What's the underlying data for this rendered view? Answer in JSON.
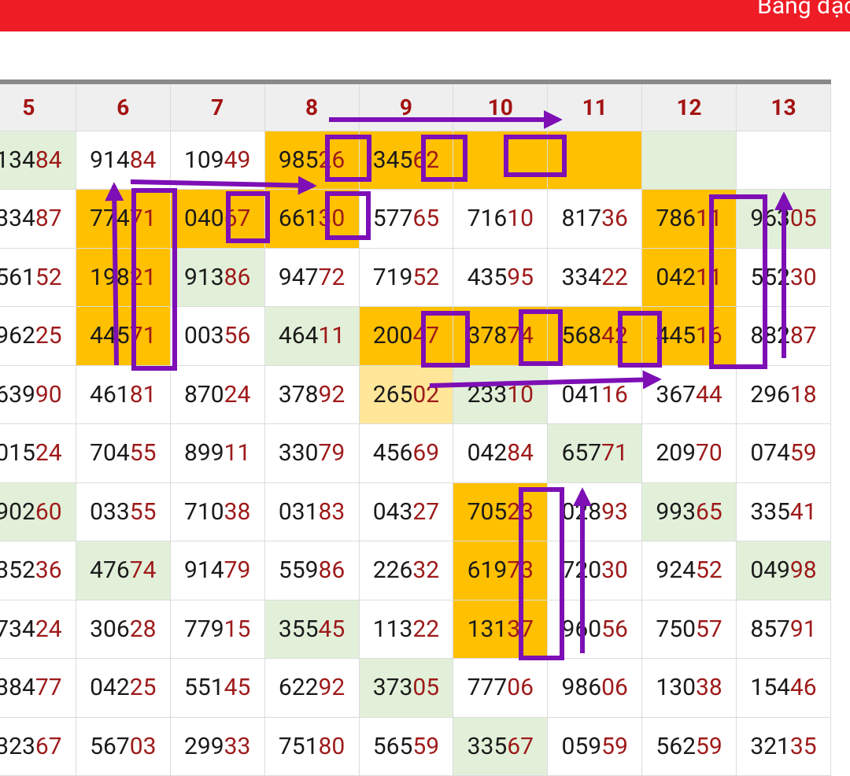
{
  "app": {
    "title": "Bảng đặc"
  },
  "table": {
    "columns": [
      "5",
      "6",
      "7",
      "8",
      "9",
      "10",
      "11",
      "12",
      "13"
    ],
    "rows": [
      [
        "13484",
        "91484",
        "10949",
        "98526",
        "34562",
        "",
        "",
        "",
        ""
      ],
      [
        "33487",
        "77471",
        "04067",
        "66130",
        "57765",
        "71610",
        "81736",
        "78611",
        "96305"
      ],
      [
        "56152",
        "19821",
        "91386",
        "94772",
        "71952",
        "43595",
        "33422",
        "04211",
        "55230"
      ],
      [
        "96225",
        "44571",
        "00356",
        "46411",
        "20047",
        "37874",
        "56842",
        "44516",
        "88287"
      ],
      [
        "63990",
        "46181",
        "87024",
        "37892",
        "26502",
        "23310",
        "04116",
        "36744",
        "29618"
      ],
      [
        "01524",
        "70455",
        "89911",
        "33079",
        "45669",
        "04284",
        "65771",
        "20970",
        "07459"
      ],
      [
        "90260",
        "03355",
        "71038",
        "03183",
        "04327",
        "70523",
        "02893",
        "99365",
        "33541"
      ],
      [
        "35236",
        "47674",
        "91479",
        "55986",
        "22632",
        "61973",
        "72030",
        "92452",
        "04998"
      ],
      [
        "73424",
        "30628",
        "77915",
        "35545",
        "11322",
        "13137",
        "96056",
        "75057",
        "85791"
      ],
      [
        "38477",
        "04225",
        "55145",
        "62292",
        "37305",
        "77706",
        "98606",
        "13038",
        "15446"
      ],
      [
        "32367",
        "56703",
        "29933",
        "75180",
        "56559",
        "33567",
        "05959",
        "56259",
        "32135"
      ]
    ],
    "cell_styles": [
      [
        "g",
        "",
        "",
        "y",
        "y",
        "y",
        "y",
        "g",
        ""
      ],
      [
        "",
        "y",
        "y",
        "y",
        "",
        "",
        "",
        "y",
        "g"
      ],
      [
        "",
        "y",
        "g",
        "",
        "",
        "",
        "",
        "y",
        ""
      ],
      [
        "",
        "y",
        "",
        "g",
        "y",
        "y",
        "y",
        "y",
        ""
      ],
      [
        "",
        "",
        "",
        "",
        "ly",
        "g",
        "",
        "",
        ""
      ],
      [
        "",
        "",
        "",
        "",
        "",
        "",
        "g",
        "",
        ""
      ],
      [
        "g",
        "",
        "",
        "",
        "",
        "y",
        "",
        "g",
        ""
      ],
      [
        "",
        "g",
        "",
        "",
        "",
        "y",
        "",
        "",
        "g"
      ],
      [
        "",
        "",
        "",
        "g",
        "",
        "y",
        "",
        "",
        ""
      ],
      [
        "",
        "",
        "",
        "",
        "g",
        "",
        "",
        "",
        ""
      ],
      [
        "",
        "",
        "",
        "",
        "",
        "g",
        "",
        "",
        ""
      ]
    ]
  },
  "annotations": {
    "color": "#7d0fb5"
  }
}
